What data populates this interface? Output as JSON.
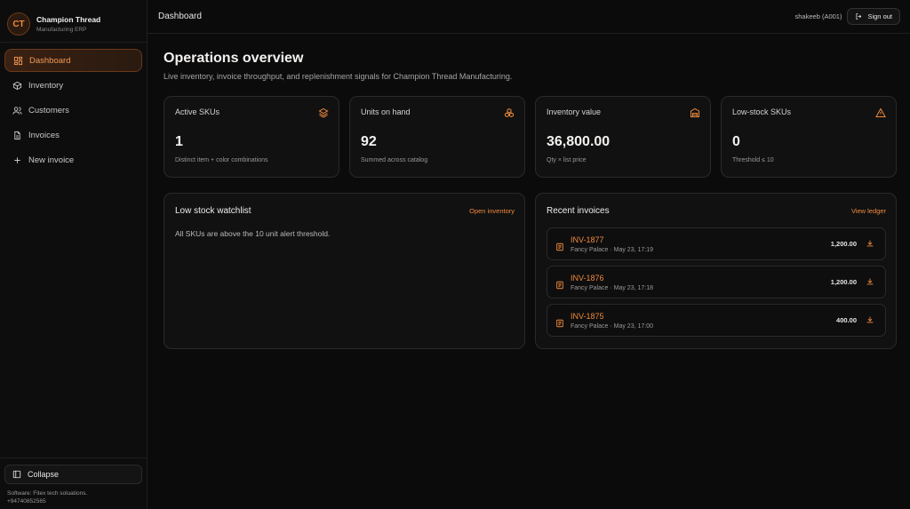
{
  "brand": {
    "initials": "CT",
    "name": "Champion Thread",
    "subtitle": "Manufacturing ERP"
  },
  "sidebar": {
    "items": [
      {
        "label": "Dashboard",
        "icon": "dashboard-icon",
        "active": true
      },
      {
        "label": "Inventory",
        "icon": "box-icon"
      },
      {
        "label": "Customers",
        "icon": "users-icon"
      },
      {
        "label": "Invoices",
        "icon": "file-icon"
      },
      {
        "label": "New invoice",
        "icon": "plus-icon"
      }
    ],
    "collapse_label": "Collapse",
    "credit_line1": "Software: Fitex tech soluations.",
    "credit_line2": "+94740852565"
  },
  "topbar": {
    "breadcrumb": "Dashboard",
    "user": "shakeeb (A001)",
    "signout_label": "Sign out"
  },
  "page": {
    "title": "Operations overview",
    "subtitle": "Live inventory, invoice throughput, and replenishment signals for Champion Thread Manufacturing."
  },
  "stats": [
    {
      "label": "Active SKUs",
      "value": "1",
      "hint": "Distinct item + color combinations",
      "icon": "layers-icon"
    },
    {
      "label": "Units on hand",
      "value": "92",
      "hint": "Summed across catalog",
      "icon": "boxes-icon"
    },
    {
      "label": "Inventory value",
      "value": "36,800.00",
      "hint": "Qty × list price",
      "icon": "warehouse-icon"
    },
    {
      "label": "Low-stock SKUs",
      "value": "0",
      "hint": "Threshold ≤ 10",
      "icon": "alert-triangle-icon"
    }
  ],
  "watchlist": {
    "title": "Low stock watchlist",
    "link": "Open inventory",
    "message": "All SKUs are above the 10 unit alert threshold."
  },
  "invoices": {
    "title": "Recent invoices",
    "link": "View ledger",
    "items": [
      {
        "number": "INV-1877",
        "meta": "Fancy Palace · May 23, 17:19",
        "amount": "1,200.00"
      },
      {
        "number": "INV-1876",
        "meta": "Fancy Palace · May 23, 17:18",
        "amount": "1,200.00"
      },
      {
        "number": "INV-1875",
        "meta": "Fancy Palace · May 23, 17:00",
        "amount": "400.00"
      }
    ]
  },
  "colors": {
    "accent": "#f08a3c",
    "background": "#0b0b0c",
    "card": "#111112"
  }
}
